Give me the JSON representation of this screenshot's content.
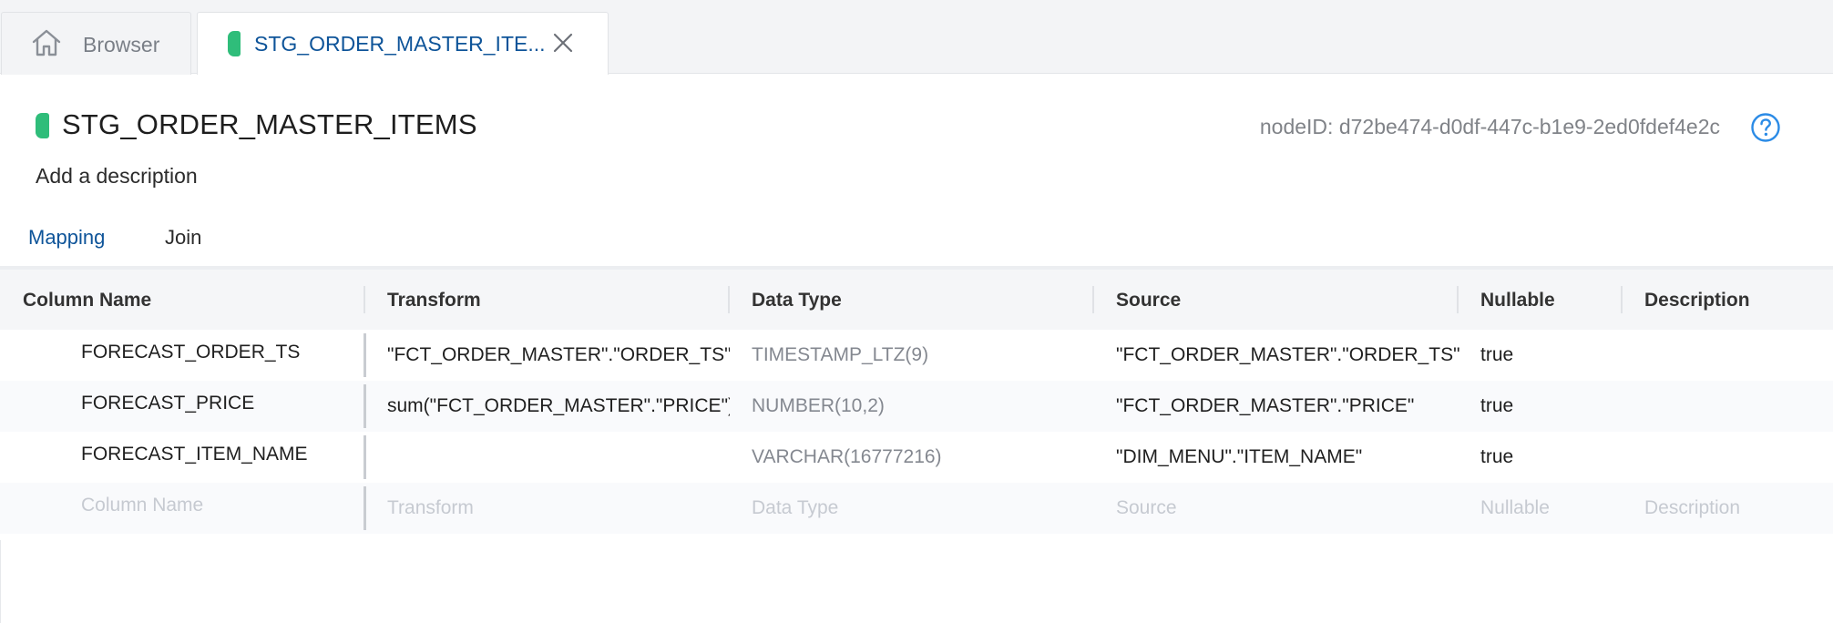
{
  "tabs": {
    "browser_label": "Browser",
    "active_label": "STG_ORDER_MASTER_ITE...",
    "node_color": "#2fbd7a"
  },
  "node": {
    "title": "STG_ORDER_MASTER_ITEMS",
    "node_id": "nodeID: d72be474-d0df-447c-b1e9-2ed0fdef4e2c",
    "description_placeholder": "Add a description"
  },
  "subtabs": {
    "mapping": "Mapping",
    "join": "Join",
    "active": "Mapping"
  },
  "grid": {
    "headers": {
      "column_name": "Column Name",
      "transform": "Transform",
      "data_type": "Data Type",
      "source": "Source",
      "nullable": "Nullable",
      "description": "Description"
    },
    "rows": [
      {
        "column_name": "FORECAST_ORDER_TS",
        "transform": "\"FCT_ORDER_MASTER\".\"ORDER_TS\"::d",
        "data_type": "TIMESTAMP_LTZ(9)",
        "source": "\"FCT_ORDER_MASTER\".\"ORDER_TS\"",
        "nullable": "true",
        "description": ""
      },
      {
        "column_name": "FORECAST_PRICE",
        "transform": "sum(\"FCT_ORDER_MASTER\".\"PRICE\")",
        "data_type": "NUMBER(10,2)",
        "source": "\"FCT_ORDER_MASTER\".\"PRICE\"",
        "nullable": "true",
        "description": ""
      },
      {
        "column_name": "FORECAST_ITEM_NAME",
        "transform": "",
        "data_type": "VARCHAR(16777216)",
        "source": "\"DIM_MENU\".\"ITEM_NAME\"",
        "nullable": "true",
        "description": ""
      }
    ],
    "placeholder_row": {
      "column_name": "Column Name",
      "transform": "Transform",
      "data_type": "Data Type",
      "source": "Source",
      "nullable": "Nullable",
      "description": "Description"
    }
  },
  "colors": {
    "accent": "#0e5499",
    "help": "#2b8be6",
    "node_chip": "#2fbd7a"
  }
}
